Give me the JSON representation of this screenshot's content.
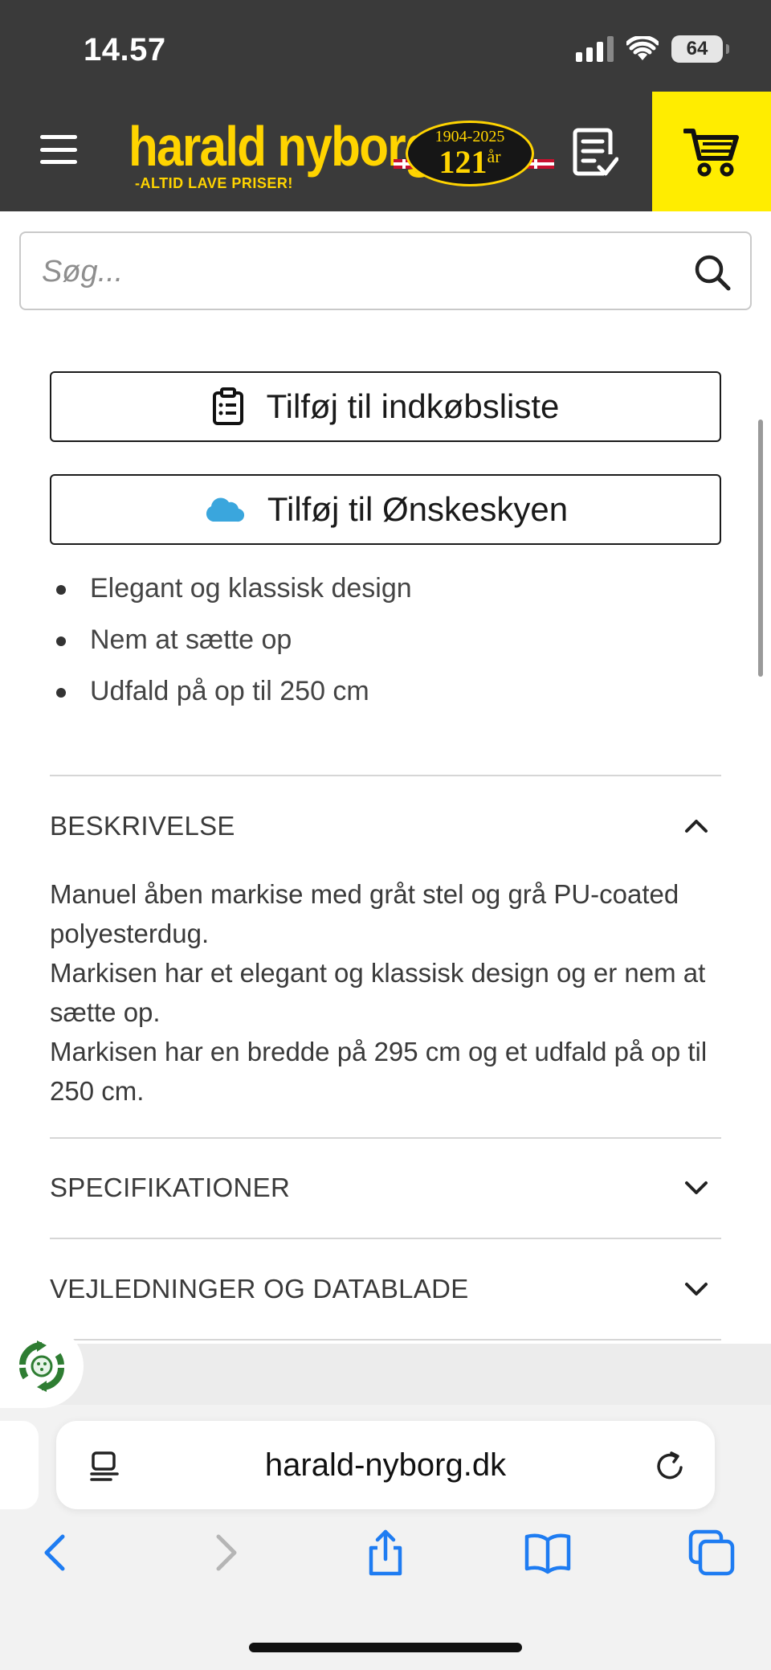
{
  "status_bar": {
    "time": "14.57",
    "battery": "64"
  },
  "header": {
    "logo_name": "harald nyborg",
    "logo_tagline": "-ALTID LAVE PRISER!",
    "badge_years": "1904-2025",
    "badge_number": "121",
    "badge_suffix": "år"
  },
  "search": {
    "placeholder": "Søg..."
  },
  "actions": {
    "shopping_list_label": "Tilføj til indkøbsliste",
    "wishlist_label": "Tilføj til Ønskeskyen"
  },
  "features": [
    "Elegant og klassisk design",
    "Nem at sætte op",
    "Udfald på op til 250 cm"
  ],
  "sections": {
    "description": {
      "title": "BESKRIVELSE",
      "paragraphs": [
        "Manuel åben markise med gråt stel og grå PU-coated polyesterdug.",
        "Markisen har et elegant og klassisk design og er nem at sætte op.",
        "Markisen har en bredde på 295 cm og et udfald på op til 250 cm."
      ]
    },
    "specifications": {
      "title": "SPECIFIKATIONER"
    },
    "guides": {
      "title": "VEJLEDNINGER OG DATABLADE"
    }
  },
  "browser": {
    "url": "harald-nyborg.dk"
  },
  "colors": {
    "header_bg": "#3a3a3a",
    "brand_yellow": "#ffd400",
    "cart_yellow": "#ffed00",
    "browser_blue": "#1e7cf2",
    "cloud_blue": "#3aa6dd",
    "recycle_green": "#2e7d32"
  }
}
